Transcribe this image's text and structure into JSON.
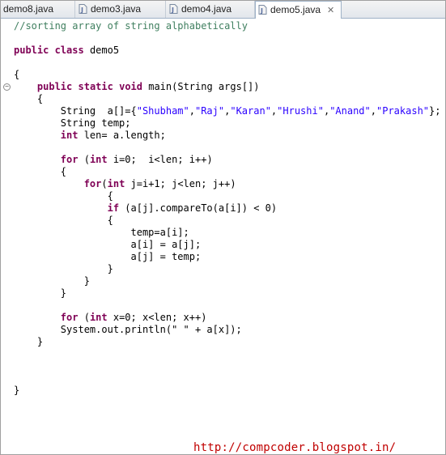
{
  "tabs": [
    {
      "label": "demo8.java",
      "active": false
    },
    {
      "label": "demo3.java",
      "active": false
    },
    {
      "label": "demo4.java",
      "active": false
    },
    {
      "label": "demo5.java",
      "active": true
    }
  ],
  "tab_close": "✕",
  "code_lines": [
    [
      [
        "cm",
        "//sorting array of string alphabetically"
      ]
    ],
    [],
    [
      [
        "kw",
        "public"
      ],
      [
        "",
        " "
      ],
      [
        "kw",
        "class"
      ],
      [
        "",
        " demo5"
      ]
    ],
    [],
    [
      [
        "",
        "{"
      ]
    ],
    [
      [
        "",
        "    "
      ],
      [
        "kw",
        "public"
      ],
      [
        "",
        " "
      ],
      [
        "kw",
        "static"
      ],
      [
        "",
        " "
      ],
      [
        "kw",
        "void"
      ],
      [
        "",
        " main(String args[])"
      ]
    ],
    [
      [
        "",
        "    {"
      ]
    ],
    [
      [
        "",
        "        String  a[]={"
      ],
      [
        "st",
        "\"Shubham\""
      ],
      [
        "",
        ","
      ],
      [
        "st",
        "\"Raj\""
      ],
      [
        "",
        ","
      ],
      [
        "st",
        "\"Karan\""
      ],
      [
        "",
        ","
      ],
      [
        "st",
        "\"Hrushi\""
      ],
      [
        "",
        ","
      ],
      [
        "st",
        "\"Anand\""
      ],
      [
        "",
        ","
      ],
      [
        "st",
        "\"Prakash\""
      ],
      [
        "",
        "};"
      ]
    ],
    [
      [
        "",
        "        String temp;"
      ]
    ],
    [
      [
        "",
        "        "
      ],
      [
        "kw",
        "int"
      ],
      [
        "",
        " len= a.length;"
      ]
    ],
    [],
    [
      [
        "",
        "        "
      ],
      [
        "kw",
        "for"
      ],
      [
        "",
        " ("
      ],
      [
        "kw",
        "int"
      ],
      [
        "",
        " i=0;  i<len; i++)"
      ]
    ],
    [
      [
        "",
        "        {"
      ]
    ],
    [
      [
        "",
        "            "
      ],
      [
        "kw",
        "for"
      ],
      [
        "",
        "("
      ],
      [
        "kw",
        "int"
      ],
      [
        "",
        " j=i+1; j<len; j++)"
      ]
    ],
    [
      [
        "",
        "                {"
      ]
    ],
    [
      [
        "",
        "                "
      ],
      [
        "kw",
        "if"
      ],
      [
        "",
        " (a[j].compareTo(a[i]) < 0)"
      ]
    ],
    [
      [
        "",
        "                {"
      ]
    ],
    [
      [
        "",
        "                    temp=a[i];"
      ]
    ],
    [
      [
        "",
        "                    a[i] = a[j];"
      ]
    ],
    [
      [
        "",
        "                    a[j] = temp;"
      ]
    ],
    [
      [
        "",
        "                }"
      ]
    ],
    [
      [
        "",
        "            }"
      ]
    ],
    [
      [
        "",
        "        }"
      ]
    ],
    [],
    [
      [
        "",
        "        "
      ],
      [
        "kw",
        "for"
      ],
      [
        "",
        " ("
      ],
      [
        "kw",
        "int"
      ],
      [
        "",
        " x=0; x<len; x++)"
      ]
    ],
    [
      [
        "",
        "        System.out.println(\" \" + a[x]);"
      ]
    ],
    [
      [
        "",
        "    }"
      ]
    ],
    [],
    [],
    [],
    [
      [
        "",
        "}"
      ]
    ]
  ],
  "watermark": "http://compcoder.blogspot.in/",
  "colors": {
    "keyword": "#7f0055",
    "comment": "#3f7f5f",
    "string": "#2a00ff",
    "watermark": "#c00000"
  }
}
